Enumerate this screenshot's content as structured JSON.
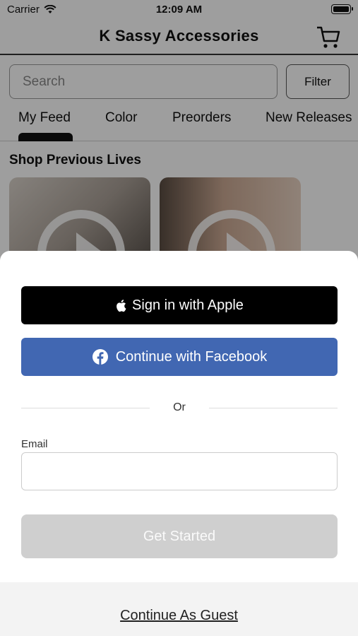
{
  "status_bar": {
    "carrier": "Carrier",
    "time": "12:09 AM"
  },
  "header": {
    "title": "K Sassy Accessories",
    "cart_icon": "cart-icon"
  },
  "search": {
    "placeholder": "Search",
    "filter_label": "Filter"
  },
  "tabs": [
    {
      "label": "My Feed",
      "active": true
    },
    {
      "label": "Color"
    },
    {
      "label": "Preorders"
    },
    {
      "label": "New Releases"
    }
  ],
  "section": {
    "title": "Shop Previous Lives"
  },
  "sheet": {
    "apple_label": "Sign in with Apple",
    "facebook_label": "Continue with Facebook",
    "or_text": "Or",
    "email_label": "Email",
    "email_value": "",
    "get_started_label": "Get Started",
    "guest_label": "Continue As Guest"
  },
  "colors": {
    "facebook": "#4167b2",
    "apple": "#000000",
    "disabled_button": "#cfcfcf",
    "overlay": "rgba(0,0,0,0.38)"
  }
}
